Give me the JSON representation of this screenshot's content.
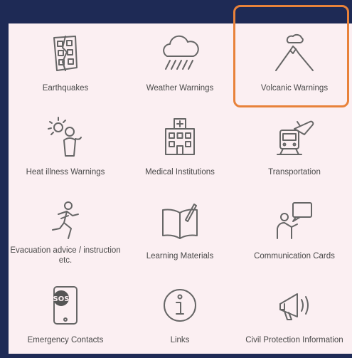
{
  "menu": {
    "items": [
      {
        "label": "Earthquakes",
        "icon": "earthquake-icon"
      },
      {
        "label": "Weather Warnings",
        "icon": "rain-cloud-icon"
      },
      {
        "label": "Volcanic Warnings",
        "icon": "volcano-icon"
      },
      {
        "label": "Heat illness Warnings",
        "icon": "heat-illness-icon"
      },
      {
        "label": "Medical Institutions",
        "icon": "hospital-icon"
      },
      {
        "label": "Transportation",
        "icon": "transportation-icon"
      },
      {
        "label": "Evacuation advice / instruction etc.",
        "icon": "evacuation-icon"
      },
      {
        "label": "Learning Materials",
        "icon": "book-icon"
      },
      {
        "label": "Communication Cards",
        "icon": "communication-card-icon"
      },
      {
        "label": "Emergency Contacts",
        "icon": "sos-phone-icon"
      },
      {
        "label": "Links",
        "icon": "info-icon"
      },
      {
        "label": "Civil Protection Information",
        "icon": "megaphone-icon"
      }
    ],
    "highlighted_item": "Volcanic Warnings"
  },
  "colors": {
    "background": "#1e2a55",
    "panel": "#fbeff2",
    "highlight": "#e8823a",
    "icon_stroke": "#666666"
  }
}
